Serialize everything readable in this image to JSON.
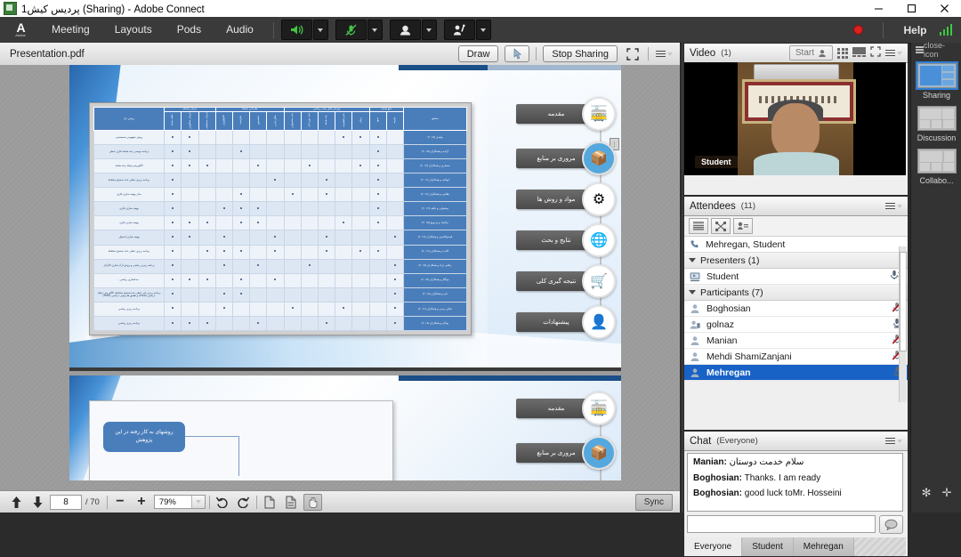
{
  "window": {
    "title": "پردیس کیش1 (Sharing) - Adobe Connect",
    "minimize": "–",
    "maximize": "□",
    "close": "✕"
  },
  "menubar": {
    "logo_letter": "A",
    "logo_word": "Adobe",
    "items": [
      {
        "label": "Meeting"
      },
      {
        "label": "Layouts"
      },
      {
        "label": "Pods"
      },
      {
        "label": "Audio"
      }
    ],
    "speaker_icon": "🔊",
    "mic_icon": "mic-muted",
    "camera_icon": "webcam",
    "hand_icon": "raise-hand",
    "help_label": "Help",
    "recording_state": "recording"
  },
  "share": {
    "document_title": "Presentation.pdf",
    "draw_label": "Draw",
    "pointer_icon": "pointer",
    "stop_sharing_label": "Stop Sharing",
    "fullscreen_icon": "fullscreen",
    "menu_icon": "pod-menu",
    "footer": {
      "page_up_icon": "arrow-up",
      "page_down_icon": "arrow-down",
      "current_page": "8",
      "total_pages": "/ 70",
      "zoom_out_icon": "−",
      "zoom_in_icon": "+",
      "zoom_level": "79%",
      "undo_icon": "undo",
      "redo_icon": "redo",
      "page_fit_icon": "fit-page",
      "page_width_icon": "fit-width",
      "hand_tool_icon": "hand",
      "sync_label": "Sync"
    },
    "slide": {
      "nav_chips": [
        {
          "label": "مقدمه",
          "icon": "🚋"
        },
        {
          "label": "مروری بر منابع",
          "icon": "📦"
        },
        {
          "label": "مواد و روش ها",
          "icon": "⚙"
        },
        {
          "label": "نتایج و بحث",
          "icon": "🌐"
        },
        {
          "label": "نتیجه گیری کلی",
          "icon": "🛒"
        },
        {
          "label": "پیشنهادات",
          "icon": "👤"
        }
      ],
      "table": {
        "group_headers": [
          "محقق",
          "تابع هدف",
          "ویژگی های مدل ریاضی",
          "طراحی شبکه",
          "جریان شبکه"
        ],
        "method_col": "روش حل",
        "sub_headers": [
          "هزینه",
          "سود",
          "زمان",
          "عدم قطعیت",
          "چند هدفه",
          "چند دوره ای",
          "چند محصولی",
          "مکان یابی",
          "تخصیص",
          "ظرفیت",
          "تکنولوژی",
          "جریان مستقیم",
          "جریان معکوس",
          "حلقه بسته"
        ],
        "rows": [
          {
            "method": "روش مفهومی-سیستمی",
            "researcher": "ولیدی  (۲۰۱۵)",
            "marks": [
              0,
              1,
              1,
              1,
              0,
              0,
              0,
              0,
              0,
              0,
              0,
              0,
              1,
              1
            ]
          },
          {
            "method": "برنامه نویسی چند هدفه فازی خطی",
            "researcher": "آزاده و همکاران (۲۰۱۵)",
            "marks": [
              0,
              1,
              0,
              0,
              0,
              0,
              0,
              0,
              0,
              1,
              0,
              0,
              1,
              1
            ]
          },
          {
            "method": "الگوریتم ژنتیک چند هدفه",
            "researcher": "معماری و همکاران (۲۰۱۴)",
            "marks": [
              0,
              1,
              1,
              0,
              0,
              1,
              0,
              0,
              1,
              0,
              0,
              1,
              1,
              1
            ]
          },
          {
            "method": "برنامه ریزی خطی عدد صحیح مختلط",
            "researcher": "ابوالف و همکاران (۲۰۱۶)",
            "marks": [
              0,
              1,
              0,
              0,
              1,
              0,
              0,
              1,
              0,
              0,
              0,
              0,
              0,
              1
            ]
          },
          {
            "method": "مدل بهینه سازی فازی",
            "researcher": "نظامی و همکاران (۲۰۱۶)",
            "marks": [
              0,
              1,
              0,
              0,
              1,
              0,
              1,
              0,
              0,
              1,
              0,
              0,
              0,
              1
            ]
          },
          {
            "method": "بهینه سازی فازی",
            "researcher": "پیشوایی و خلف (۲۰۱۶)",
            "marks": [
              0,
              1,
              0,
              0,
              0,
              0,
              0,
              0,
              1,
              1,
              1,
              0,
              0,
              1
            ]
          },
          {
            "method": "بهینه سازی فازی",
            "researcher": "نیکنژاد و پدرویچ (۲۰۱۵)",
            "marks": [
              0,
              1,
              0,
              1,
              0,
              0,
              0,
              0,
              1,
              1,
              0,
              1,
              1,
              1
            ]
          },
          {
            "method": "بهینه سازی استوار",
            "researcher": "قیسوکاسین و همکاران (۲۰۱۷)",
            "marks": [
              1,
              0,
              0,
              0,
              1,
              0,
              0,
              1,
              0,
              0,
              1,
              0,
              1,
              1
            ]
          },
          {
            "method": "برنامه ریزی خطی عدد صحیح مختلط",
            "researcher": "آلابت و همکاران (۲۰۱۶)",
            "marks": [
              0,
              1,
              1,
              0,
              1,
              0,
              0,
              1,
              0,
              1,
              1,
              1,
              0,
              1
            ]
          },
          {
            "method": "برنامه ریزی ریاضی و روش آزاد سازی لاگرانژ",
            "researcher": "رافعی نژاد و همکاران (۲۰۱۵)",
            "marks": [
              1,
              0,
              0,
              0,
              0,
              1,
              0,
              0,
              1,
              0,
              1,
              0,
              0,
              1
            ]
          },
          {
            "method": "مدلسازی ریاضی",
            "researcher": "موگال و همکاران (۲۰۱۵)",
            "marks": [
              1,
              0,
              0,
              0,
              0,
              0,
              0,
              1,
              0,
              1,
              0,
              1,
              1,
              1
            ]
          },
          {
            "method": "برنامه ریزی غیر خطی عددصحیح مختلط، الگوریتم ژنتیک ترکیبی (HGA) و تعلیق هارمونی ترکیبی (HHS)",
            "researcher": "دای و همکاران (۲۰۱۸)",
            "marks": [
              1,
              0,
              0,
              0,
              0,
              0,
              0,
              0,
              0,
              1,
              1,
              0,
              0,
              1
            ]
          },
          {
            "method": "برنامه ریزی ریاضی",
            "researcher": "غیاثی رسی و همکاران (۲۰۱۶)",
            "marks": [
              1,
              0,
              0,
              1,
              0,
              0,
              1,
              0,
              0,
              0,
              1,
              0,
              0,
              1
            ]
          },
          {
            "method": "برنامه ریزی ریاضی",
            "researcher": "بوکان و همکاران (۲۰۱۸)",
            "marks": [
              1,
              0,
              0,
              0,
              1,
              0,
              0,
              0,
              1,
              0,
              0,
              1,
              1,
              1
            ]
          }
        ]
      },
      "slide2_box": "روشهای به کار رفته در این پژوهش"
    }
  },
  "video_pod": {
    "title": "Video",
    "count": "(1)",
    "start_label": "Start",
    "start_icon": "person",
    "grid_icon": "grid-view",
    "single_icon": "single-view",
    "fullscreen_icon": "fullscreen",
    "menu_icon": "pod-menu",
    "participant_label": "Student"
  },
  "attendees_pod": {
    "title": "Attendees",
    "count": "(11)",
    "menu_icon": "pod-menu",
    "tool_icons": [
      "list-view",
      "breakout-view",
      "name-sort"
    ],
    "host_row": {
      "icon": "phone-icon",
      "label": "Mehregan, Student"
    },
    "groups": [
      {
        "label": "Presenters (1)",
        "members": [
          {
            "name": "Student",
            "icon": "presenter-icon",
            "mic": "mic-active"
          }
        ]
      },
      {
        "label": "Participants (7)",
        "members": [
          {
            "name": "Boghosian",
            "icon": "person-icon",
            "mic": "mic-muted"
          },
          {
            "name": "golnaz",
            "icon": "person-mobile-icon",
            "mic": "mic-on"
          },
          {
            "name": "Manian",
            "icon": "person-icon",
            "mic": "mic-muted"
          },
          {
            "name": "Mehdi ShamiZanjani",
            "icon": "person-icon",
            "mic": "mic-muted"
          },
          {
            "name": "Mehregan",
            "icon": "person-icon",
            "mic": "mic-on",
            "selected": true
          }
        ]
      }
    ]
  },
  "chat_pod": {
    "title": "Chat",
    "scope": "(Everyone)",
    "menu_icon": "pod-menu",
    "messages": [
      {
        "who": "Manian:",
        "text": "سلام خدمت دوستان",
        "rtl": true
      },
      {
        "who": "Boghosian:",
        "text": "Thanks. I am ready",
        "rtl": false
      },
      {
        "who": "Boghosian:",
        "text": "good luck toMr. Hosseini",
        "rtl": false
      }
    ],
    "input_placeholder": "",
    "send_icon": "chat-bubble",
    "tabs": [
      {
        "label": "Everyone",
        "active": true
      },
      {
        "label": "Student",
        "active": false
      },
      {
        "label": "Mehregan",
        "active": false
      }
    ]
  },
  "layout_bar": {
    "menu_icon": "pod-menu",
    "close_icon": "close-icon",
    "layouts": [
      {
        "name": "Sharing",
        "selected": true
      },
      {
        "name": "Discussion",
        "selected": false
      },
      {
        "name": "Collabo...",
        "selected": false
      }
    ],
    "bottom_icons": [
      "wrench-icon",
      "plus-icon"
    ]
  }
}
